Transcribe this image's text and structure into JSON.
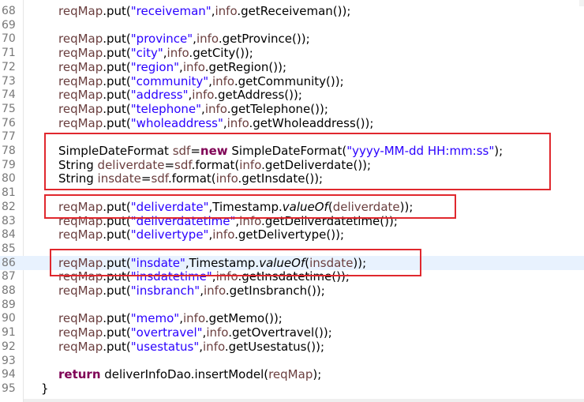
{
  "editor": {
    "lines": [
      {
        "num": "68",
        "current": false,
        "tokens": [
          {
            "t": "reqMap",
            "c": "v"
          },
          {
            "t": ".put(",
            "c": ""
          },
          {
            "t": "\"receiveman\"",
            "c": "s"
          },
          {
            "t": ",",
            "c": ""
          },
          {
            "t": "info",
            "c": "v"
          },
          {
            "t": ".getReceiveman());",
            "c": ""
          }
        ]
      },
      {
        "num": "69",
        "current": false,
        "tokens": []
      },
      {
        "num": "70",
        "current": false,
        "tokens": [
          {
            "t": "reqMap",
            "c": "v"
          },
          {
            "t": ".put(",
            "c": ""
          },
          {
            "t": "\"province\"",
            "c": "s"
          },
          {
            "t": ",",
            "c": ""
          },
          {
            "t": "info",
            "c": "v"
          },
          {
            "t": ".getProvince());",
            "c": ""
          }
        ]
      },
      {
        "num": "71",
        "current": false,
        "tokens": [
          {
            "t": "reqMap",
            "c": "v"
          },
          {
            "t": ".put(",
            "c": ""
          },
          {
            "t": "\"city\"",
            "c": "s"
          },
          {
            "t": ",",
            "c": ""
          },
          {
            "t": "info",
            "c": "v"
          },
          {
            "t": ".getCity());",
            "c": ""
          }
        ]
      },
      {
        "num": "72",
        "current": false,
        "tokens": [
          {
            "t": "reqMap",
            "c": "v"
          },
          {
            "t": ".put(",
            "c": ""
          },
          {
            "t": "\"region\"",
            "c": "s"
          },
          {
            "t": ",",
            "c": ""
          },
          {
            "t": "info",
            "c": "v"
          },
          {
            "t": ".getRegion());",
            "c": ""
          }
        ]
      },
      {
        "num": "73",
        "current": false,
        "tokens": [
          {
            "t": "reqMap",
            "c": "v"
          },
          {
            "t": ".put(",
            "c": ""
          },
          {
            "t": "\"community\"",
            "c": "s"
          },
          {
            "t": ",",
            "c": ""
          },
          {
            "t": "info",
            "c": "v"
          },
          {
            "t": ".getCommunity());",
            "c": ""
          }
        ]
      },
      {
        "num": "74",
        "current": false,
        "tokens": [
          {
            "t": "reqMap",
            "c": "v"
          },
          {
            "t": ".put(",
            "c": ""
          },
          {
            "t": "\"address\"",
            "c": "s"
          },
          {
            "t": ",",
            "c": ""
          },
          {
            "t": "info",
            "c": "v"
          },
          {
            "t": ".getAddress());",
            "c": ""
          }
        ]
      },
      {
        "num": "75",
        "current": false,
        "tokens": [
          {
            "t": "reqMap",
            "c": "v"
          },
          {
            "t": ".put(",
            "c": ""
          },
          {
            "t": "\"telephone\"",
            "c": "s"
          },
          {
            "t": ",",
            "c": ""
          },
          {
            "t": "info",
            "c": "v"
          },
          {
            "t": ".getTelephone());",
            "c": ""
          }
        ]
      },
      {
        "num": "76",
        "current": false,
        "tokens": [
          {
            "t": "reqMap",
            "c": "v"
          },
          {
            "t": ".put(",
            "c": ""
          },
          {
            "t": "\"wholeaddress\"",
            "c": "s"
          },
          {
            "t": ",",
            "c": ""
          },
          {
            "t": "info",
            "c": "v"
          },
          {
            "t": ".getWholeaddress());",
            "c": ""
          }
        ]
      },
      {
        "num": "77",
        "current": false,
        "tokens": []
      },
      {
        "num": "78",
        "current": false,
        "tokens": [
          {
            "t": "SimpleDateFormat ",
            "c": ""
          },
          {
            "t": "sdf",
            "c": "v"
          },
          {
            "t": "=",
            "c": ""
          },
          {
            "t": "new",
            "c": "kw"
          },
          {
            "t": " SimpleDateFormat(",
            "c": ""
          },
          {
            "t": "\"yyyy-MM-dd HH:mm:ss\"",
            "c": "s"
          },
          {
            "t": ");",
            "c": ""
          }
        ]
      },
      {
        "num": "79",
        "current": false,
        "tokens": [
          {
            "t": "String ",
            "c": ""
          },
          {
            "t": "deliverdate",
            "c": "v"
          },
          {
            "t": "=",
            "c": ""
          },
          {
            "t": "sdf",
            "c": "v"
          },
          {
            "t": ".format(",
            "c": ""
          },
          {
            "t": "info",
            "c": "v"
          },
          {
            "t": ".getDeliverdate());",
            "c": ""
          }
        ]
      },
      {
        "num": "80",
        "current": false,
        "tokens": [
          {
            "t": "String ",
            "c": ""
          },
          {
            "t": "insdate",
            "c": "v"
          },
          {
            "t": "=",
            "c": ""
          },
          {
            "t": "sdf",
            "c": "v"
          },
          {
            "t": ".format(",
            "c": ""
          },
          {
            "t": "info",
            "c": "v"
          },
          {
            "t": ".getInsdate());",
            "c": ""
          }
        ]
      },
      {
        "num": "81",
        "current": false,
        "tokens": []
      },
      {
        "num": "82",
        "current": false,
        "tokens": [
          {
            "t": "reqMap",
            "c": "v"
          },
          {
            "t": ".put(",
            "c": ""
          },
          {
            "t": "\"deliverdate\"",
            "c": "s"
          },
          {
            "t": ",Timestamp.",
            "c": ""
          },
          {
            "t": "valueOf",
            "c": "it"
          },
          {
            "t": "(",
            "c": ""
          },
          {
            "t": "deliverdate",
            "c": "v"
          },
          {
            "t": "));",
            "c": ""
          }
        ]
      },
      {
        "num": "83",
        "current": false,
        "tokens": [
          {
            "t": "reqMap",
            "c": "v"
          },
          {
            "t": ".put(",
            "c": ""
          },
          {
            "t": "\"deliverdatetime\"",
            "c": "s"
          },
          {
            "t": ",",
            "c": ""
          },
          {
            "t": "info",
            "c": "v"
          },
          {
            "t": ".getDeliverdatetime());",
            "c": ""
          }
        ]
      },
      {
        "num": "84",
        "current": false,
        "tokens": [
          {
            "t": "reqMap",
            "c": "v"
          },
          {
            "t": ".put(",
            "c": ""
          },
          {
            "t": "\"delivertype\"",
            "c": "s"
          },
          {
            "t": ",",
            "c": ""
          },
          {
            "t": "info",
            "c": "v"
          },
          {
            "t": ".getDelivertype());",
            "c": ""
          }
        ]
      },
      {
        "num": "85",
        "current": false,
        "tokens": []
      },
      {
        "num": "86",
        "current": true,
        "tokens": [
          {
            "t": "reqMap",
            "c": "v"
          },
          {
            "t": ".put(",
            "c": ""
          },
          {
            "t": "\"insdate\"",
            "c": "s"
          },
          {
            "t": ",Timestamp.",
            "c": ""
          },
          {
            "t": "valueOf",
            "c": "it"
          },
          {
            "t": "(",
            "c": ""
          },
          {
            "t": "insdate",
            "c": "v"
          },
          {
            "t": "));",
            "c": ""
          }
        ]
      },
      {
        "num": "87",
        "current": false,
        "tokens": [
          {
            "t": "reqMap",
            "c": "v"
          },
          {
            "t": ".put(",
            "c": ""
          },
          {
            "t": "\"insdatetime\"",
            "c": "s"
          },
          {
            "t": ",",
            "c": ""
          },
          {
            "t": "info",
            "c": "v"
          },
          {
            "t": ".getInsdatetime());",
            "c": ""
          }
        ]
      },
      {
        "num": "88",
        "current": false,
        "tokens": [
          {
            "t": "reqMap",
            "c": "v"
          },
          {
            "t": ".put(",
            "c": ""
          },
          {
            "t": "\"insbranch\"",
            "c": "s"
          },
          {
            "t": ",",
            "c": ""
          },
          {
            "t": "info",
            "c": "v"
          },
          {
            "t": ".getInsbranch());",
            "c": ""
          }
        ]
      },
      {
        "num": "89",
        "current": false,
        "tokens": []
      },
      {
        "num": "90",
        "current": false,
        "tokens": [
          {
            "t": "reqMap",
            "c": "v"
          },
          {
            "t": ".put(",
            "c": ""
          },
          {
            "t": "\"memo\"",
            "c": "s"
          },
          {
            "t": ",",
            "c": ""
          },
          {
            "t": "info",
            "c": "v"
          },
          {
            "t": ".getMemo());",
            "c": ""
          }
        ]
      },
      {
        "num": "91",
        "current": false,
        "tokens": [
          {
            "t": "reqMap",
            "c": "v"
          },
          {
            "t": ".put(",
            "c": ""
          },
          {
            "t": "\"overtravel\"",
            "c": "s"
          },
          {
            "t": ",",
            "c": ""
          },
          {
            "t": "info",
            "c": "v"
          },
          {
            "t": ".getOvertravel());",
            "c": ""
          }
        ]
      },
      {
        "num": "92",
        "current": false,
        "tokens": [
          {
            "t": "reqMap",
            "c": "v"
          },
          {
            "t": ".put(",
            "c": ""
          },
          {
            "t": "\"usestatus\"",
            "c": "s"
          },
          {
            "t": ",",
            "c": ""
          },
          {
            "t": "info",
            "c": "v"
          },
          {
            "t": ".getUsestatus());",
            "c": ""
          }
        ]
      },
      {
        "num": "93",
        "current": false,
        "tokens": []
      },
      {
        "num": "94",
        "current": false,
        "tokens": [
          {
            "t": "return",
            "c": "kw"
          },
          {
            "t": " deliverInfoDao.insertModel(",
            "c": ""
          },
          {
            "t": "reqMap",
            "c": "v"
          },
          {
            "t": ");",
            "c": ""
          }
        ]
      },
      {
        "num": "95",
        "current": false,
        "closing": true,
        "tokens": [
          {
            "t": "}",
            "c": ""
          }
        ]
      }
    ]
  },
  "colors": {
    "variable": "#6a3e3e",
    "string": "#2a00ff",
    "keyword": "#7f0055",
    "line_number": "#787878",
    "current_line": "#e8f2fe",
    "highlight_box": "#e0282e"
  }
}
